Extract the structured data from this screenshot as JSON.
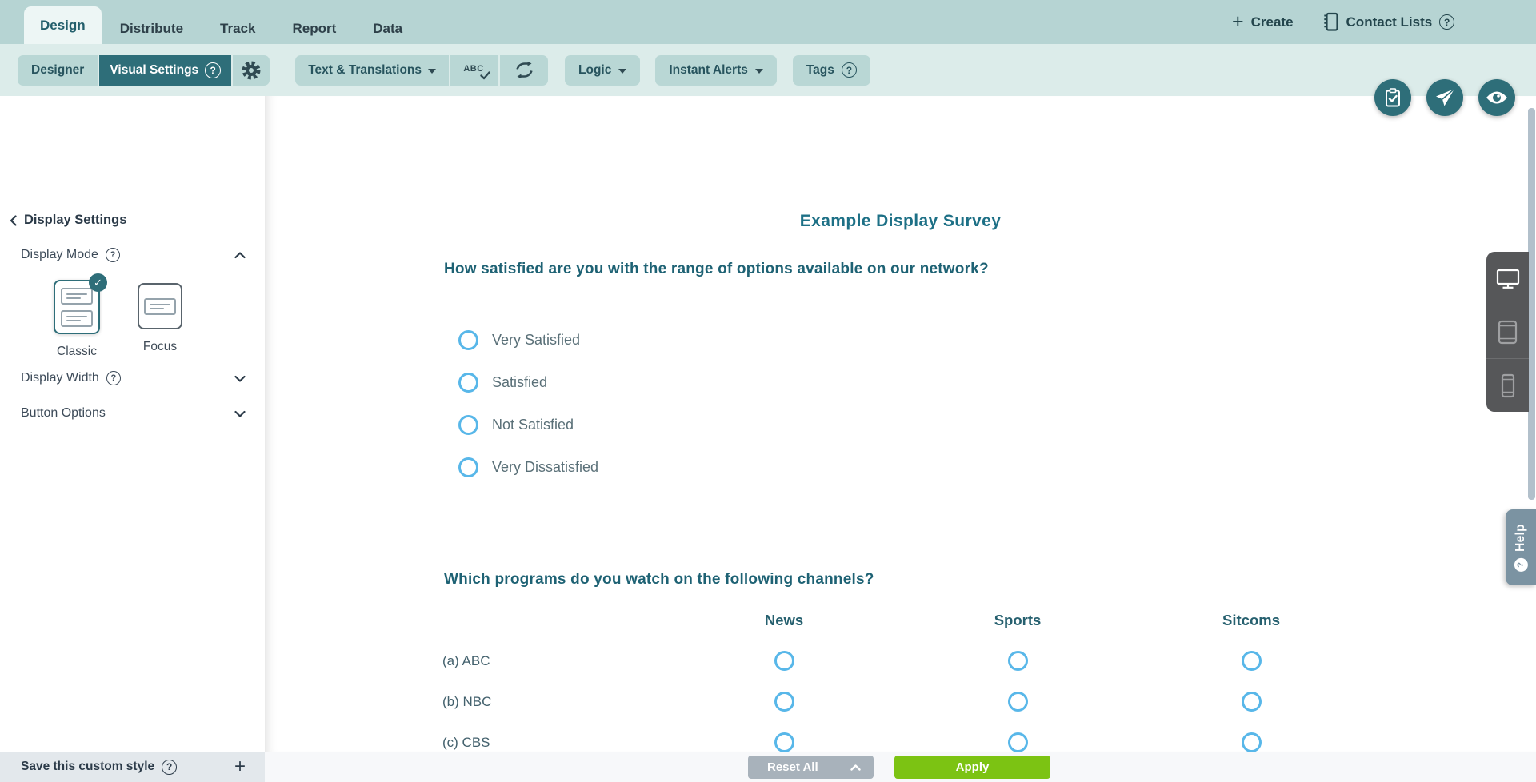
{
  "top_nav": {
    "tabs": [
      {
        "label": "Design",
        "active": true
      },
      {
        "label": "Distribute",
        "active": false
      },
      {
        "label": "Track",
        "active": false
      },
      {
        "label": "Report",
        "active": false
      },
      {
        "label": "Data",
        "active": false
      }
    ],
    "create_label": "Create",
    "contact_lists_label": "Contact Lists"
  },
  "toolbar": {
    "designer_label": "Designer",
    "visual_settings_label": "Visual Settings",
    "text_translations_label": "Text & Translations",
    "abc_label": "ABC",
    "logic_label": "Logic",
    "instant_alerts_label": "Instant Alerts",
    "tags_label": "Tags"
  },
  "sidebar": {
    "header": "Display Settings",
    "display_mode_label": "Display Mode",
    "modes": [
      {
        "label": "Classic",
        "selected": true
      },
      {
        "label": "Focus",
        "selected": false
      }
    ],
    "display_width_label": "Display Width",
    "button_options_label": "Button Options",
    "save_style_label": "Save this custom style"
  },
  "survey": {
    "title": "Example Display Survey",
    "question1": {
      "text": "How satisfied are you with the range of options available on our network?",
      "options": [
        "Very Satisfied",
        "Satisfied",
        "Not Satisfied",
        "Very Dissatisfied"
      ]
    },
    "question2": {
      "text": "Which programs do you watch on the following channels?",
      "columns": [
        "News",
        "Sports",
        "Sitcoms"
      ],
      "rows": [
        "(a) ABC",
        "(b) NBC",
        "(c) CBS"
      ]
    }
  },
  "actions": {
    "reset_label": "Reset All",
    "apply_label": "Apply"
  },
  "help_label": "Help",
  "icons": {
    "create": "plus-icon",
    "contact_lists": "notebook-icon",
    "visual_settings_help": "question-circle-icon",
    "settings": "gear-icon",
    "spell_check": "abc-check-icon",
    "find_replace": "sync-arrows-icon",
    "fab_1": "clipboard-check-icon",
    "fab_2": "paper-plane-icon",
    "fab_3": "eye-icon",
    "devices": [
      "desktop-icon",
      "tablet-icon",
      "mobile-icon"
    ]
  },
  "colors": {
    "accent_teal": "#2e6e79",
    "header_bar": "#b6d4d3",
    "toolbar_bar": "#dcecea",
    "button_teal": "#b9d7d5",
    "radio_blue": "#58b7e9",
    "apply_green": "#7cc313",
    "reset_gray": "#a8b2bb",
    "help_tab": "#7b93a2",
    "device_panel": "#565759",
    "survey_text": "#1e6274",
    "title_text": "#1d7086"
  }
}
